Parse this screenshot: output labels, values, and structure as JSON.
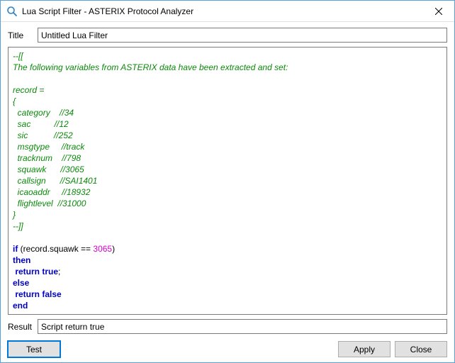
{
  "window": {
    "title": "Lua Script Filter - ASTERIX Protocol Analyzer",
    "icon": "magnifier-icon",
    "close_label": "Close"
  },
  "fields": {
    "title_label": "Title",
    "title_value": "Untitled Lua Filter",
    "result_label": "Result",
    "result_value": "Script return true"
  },
  "code": {
    "comment_open": "--[[",
    "comment_intro": "The following variables from ASTERIX data have been extracted and set:",
    "record_header": "record =",
    "brace_open": "{",
    "fields": [
      {
        "name": "category",
        "pad": "    ",
        "value": "//34"
      },
      {
        "name": "sac",
        "pad": "          ",
        "value": "//12"
      },
      {
        "name": "sic",
        "pad": "           ",
        "value": "//252"
      },
      {
        "name": "msgtype",
        "pad": "     ",
        "value": "//track"
      },
      {
        "name": "tracknum",
        "pad": "    ",
        "value": "//798"
      },
      {
        "name": "squawk",
        "pad": "      ",
        "value": "//3065"
      },
      {
        "name": "callsign",
        "pad": "      ",
        "value": "//SAI1401"
      },
      {
        "name": "icaoaddr",
        "pad": "     ",
        "value": "//18932"
      },
      {
        "name": "flightlevel",
        "pad": "  ",
        "value": "//31000"
      }
    ],
    "brace_close": "}",
    "comment_close": "--]]",
    "logic": {
      "if_kw": "if",
      "if_rest_pre": " (record.squawk == ",
      "if_num": "3065",
      "if_rest_post": ")",
      "then_kw": "then",
      "return1_kw": " return true",
      "semicolon": ";",
      "else_kw": "else",
      "return2_kw": " return false",
      "end_kw": "end"
    }
  },
  "buttons": {
    "test": "Test",
    "apply": "Apply",
    "close": "Close"
  }
}
